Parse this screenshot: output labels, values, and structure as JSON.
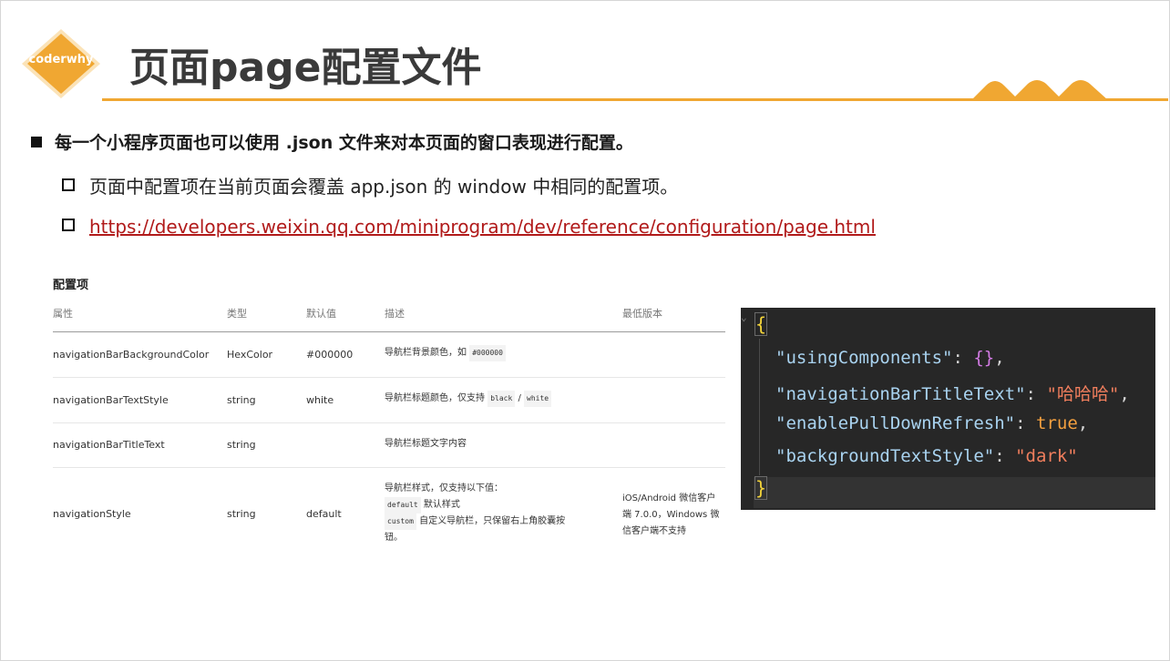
{
  "logo": {
    "text": "coderwhy"
  },
  "title": "页面page配置文件",
  "bullets": {
    "main": "每一个小程序页面也可以使用 .json 文件来对本页面的窗口表现进行配置。",
    "sub1": "页面中配置项在当前页面会覆盖 app.json 的 window 中相同的配置项。",
    "link": "https://developers.weixin.qq.com/miniprogram/dev/reference/configuration/page.html"
  },
  "table": {
    "title": "配置项",
    "headers": [
      "属性",
      "类型",
      "默认值",
      "描述",
      "最低版本"
    ],
    "rows": [
      {
        "name": "navigationBarBackgroundColor",
        "type": "HexColor",
        "default": "#000000",
        "desc_text": "导航栏背景颜色，如",
        "desc_code": "#000000",
        "version": ""
      },
      {
        "name": "navigationBarTextStyle",
        "type": "string",
        "default": "white",
        "desc_text": "导航栏标题颜色，仅支持",
        "desc_code1": "black",
        "desc_sep": "/",
        "desc_code2": "white",
        "version": ""
      },
      {
        "name": "navigationBarTitleText",
        "type": "string",
        "default": "",
        "desc_text": "导航栏标题文字内容",
        "version": ""
      },
      {
        "name": "navigationStyle",
        "type": "string",
        "default": "default",
        "desc_line1": "导航栏样式，仅支持以下值：",
        "desc_code_a": "default",
        "desc_text_a": "默认样式",
        "desc_code_b": "custom",
        "desc_text_b": "自定义导航栏，只保留右上角胶囊按",
        "desc_line4": "钮。",
        "version_l1": "iOS/Android 微信客户",
        "version_l2": "端 7.0.0，Windows 微",
        "version_l3": "信客户端不支持"
      }
    ]
  },
  "code": {
    "open": "{",
    "close": "}",
    "lines": [
      {
        "key": "\"usingComponents\"",
        "colon": ": ",
        "value": "{}",
        "comma": ","
      },
      {
        "key": "\"navigationBarTitleText\"",
        "colon": ": ",
        "value": "\"哈哈哈\"",
        "comma": ","
      },
      {
        "key": "\"enablePullDownRefresh\"",
        "colon": ": ",
        "value": "true",
        "comma": ","
      },
      {
        "key": "\"backgroundTextStyle\"",
        "colon": ": ",
        "value": "\"dark\"",
        "comma": ""
      }
    ]
  },
  "colors": {
    "accent": "#f0a732",
    "link": "#b11a1a",
    "editor_bg": "#272727"
  }
}
